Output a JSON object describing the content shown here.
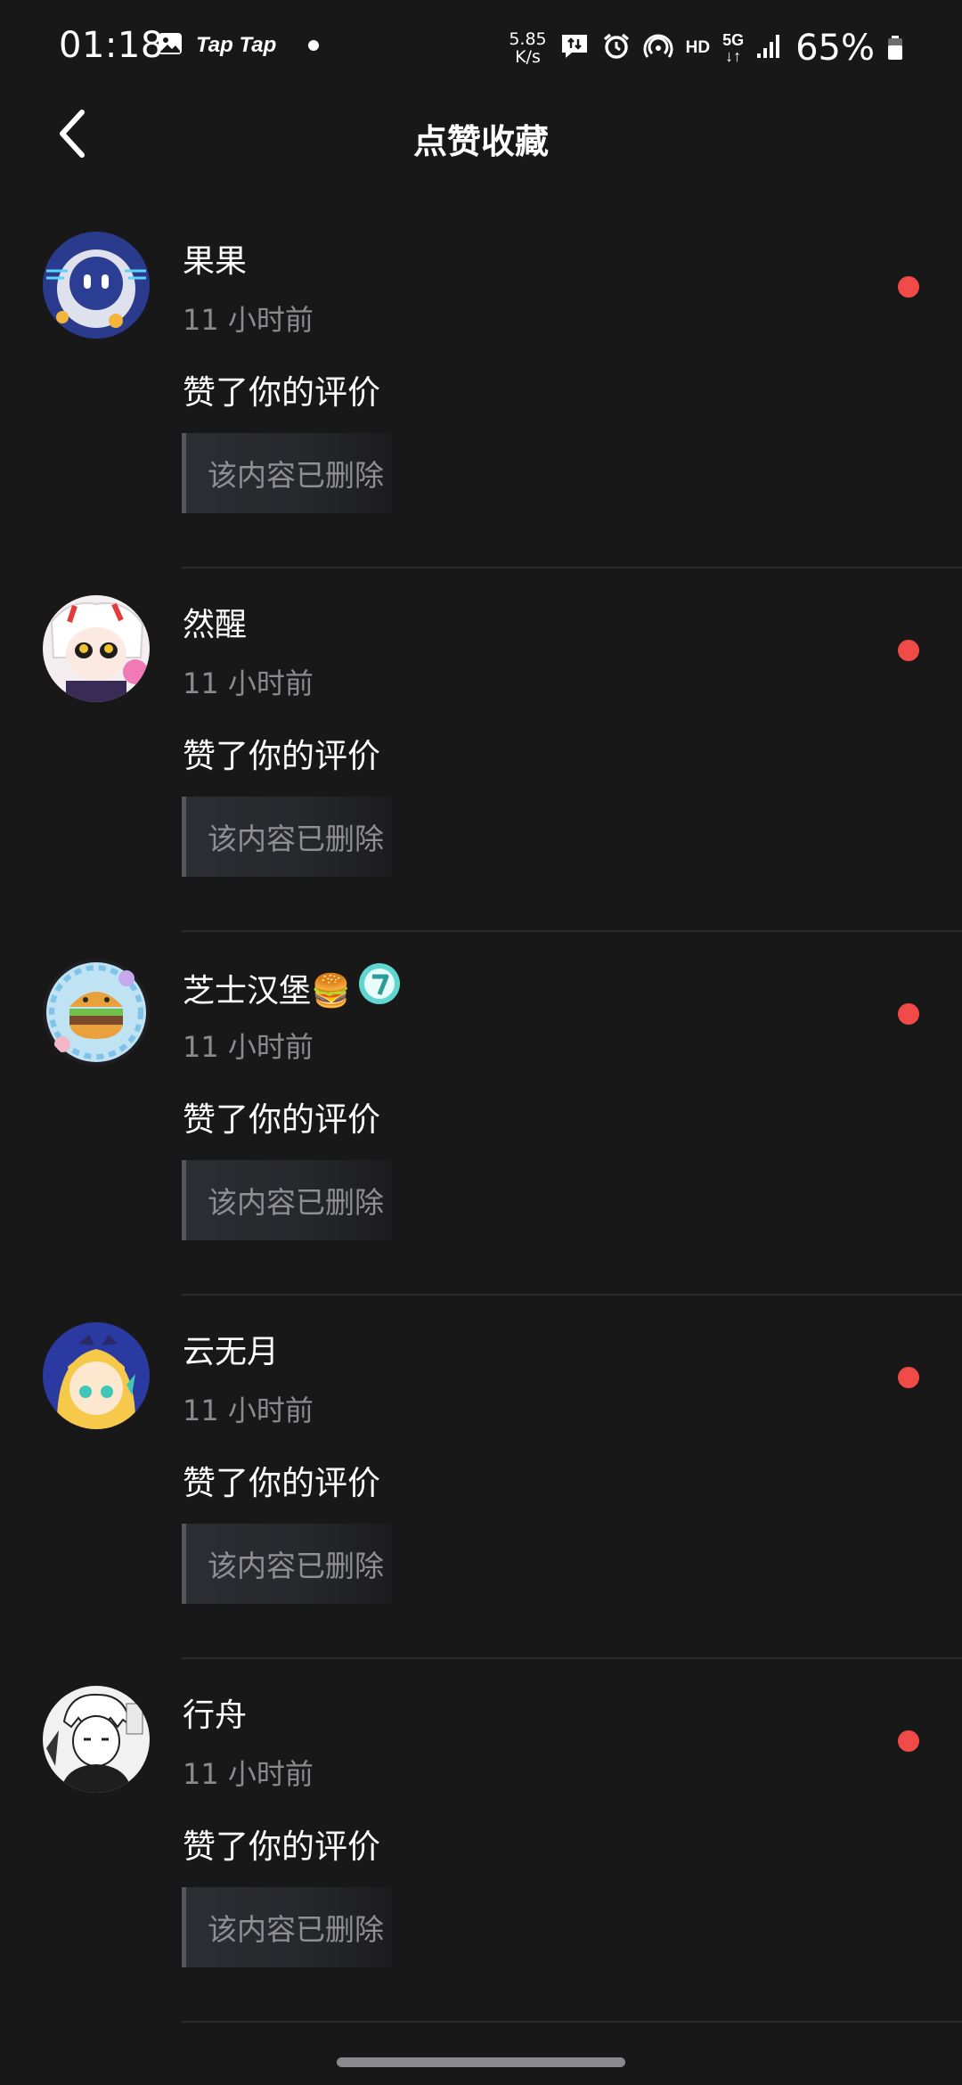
{
  "status_bar": {
    "time": "01:18",
    "app_name": "Tap Tap",
    "speed_value": "5.85",
    "speed_unit": "K/s",
    "hd": "HD",
    "network": "5G",
    "battery": "65%",
    "icons": [
      "gallery-icon",
      "message-icon",
      "alarm-icon",
      "hotspot-icon",
      "signal-icon",
      "battery-icon"
    ]
  },
  "header": {
    "title": "点赞收藏",
    "back_icon": "back-chevron-icon"
  },
  "notifications": [
    {
      "name": "果果",
      "time": "11 小时前",
      "action": "赞了你的评价",
      "content": "该内容已删除",
      "unread": true
    },
    {
      "name": "然醒",
      "time": "11 小时前",
      "action": "赞了你的评价",
      "content": "该内容已删除",
      "unread": true
    },
    {
      "name": "芝士汉堡🍔",
      "time": "11 小时前",
      "action": "赞了你的评价",
      "content": "该内容已删除",
      "unread": true,
      "badge": "verified-badge-icon"
    },
    {
      "name": "云无月",
      "time": "11 小时前",
      "action": "赞了你的评价",
      "content": "该内容已删除",
      "unread": true
    },
    {
      "name": "行舟",
      "time": "11 小时前",
      "action": "赞了你的评价",
      "content": "该内容已删除",
      "unread": true
    }
  ],
  "colors": {
    "background": "#181819",
    "unread_dot": "#f04b48",
    "secondary_text": "#8b8b8f",
    "badge": "#5fd6d0"
  }
}
